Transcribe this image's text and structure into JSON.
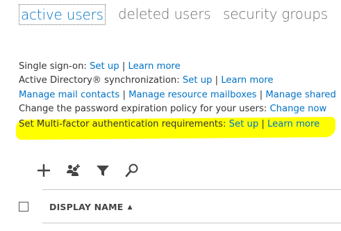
{
  "tabs": [
    {
      "label": "active users",
      "active": true
    },
    {
      "label": "deleted users",
      "active": false
    },
    {
      "label": "security groups",
      "active": false
    }
  ],
  "settings": {
    "sso": {
      "label": "Single sign-on: ",
      "setup": "Set up",
      "sep": " | ",
      "learn": "Learn more"
    },
    "adsync": {
      "label": "Active Directory® synchronization: ",
      "setup": "Set up",
      "sep": " |  ",
      "learn": "Learn more"
    },
    "manage": {
      "mail_contacts": "Manage mail contacts",
      "sep1": " | ",
      "resource_mailboxes": "Manage resource mailboxes",
      "sep2": " | ",
      "shared": "Manage shared"
    },
    "password": {
      "label": "Change the password expiration policy for your users: ",
      "change": "Change now"
    },
    "mfa": {
      "label": "Set Multi-factor authentication requirements: ",
      "setup": "Set up",
      "sep": " | ",
      "learn": "Learn more"
    }
  },
  "toolbar": {
    "icons": [
      "add-icon",
      "bulk-add-icon",
      "filter-icon",
      "search-icon"
    ]
  },
  "table": {
    "header": "DISPLAY NAME",
    "sort_indicator": "▲"
  },
  "colors": {
    "link": "#0072c6",
    "highlight": "#ffff00",
    "text": "#333333"
  }
}
